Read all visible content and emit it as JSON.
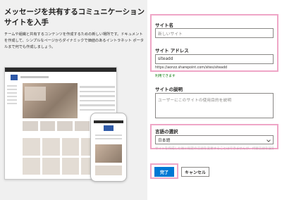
{
  "left": {
    "heading": "メッセージを共有するコミュニケーション サイトを入手",
    "description": "チームや組織と共有するコンテンツを作成するための新しい場所です。ドキュメントを作成して、シンプルなページからダイナミックで価値のあるイントラネット ポータルまで何でも作成しましょう。"
  },
  "form": {
    "site_name_label": "サイト名",
    "site_name_value": "新しいサイト",
    "site_address_label": "サイト アドレス",
    "site_address_value": "siteadd",
    "site_url": "https://aonzz.sharepoint.com/sites/siteadd",
    "availability": "利用できます",
    "description_label": "サイトの説明",
    "description_placeholder": "ユーザーにこのサイトの使用目的を説明",
    "language_label": "言語の選択",
    "language_value": "日本語",
    "language_note": "サイトを作成した後に既定の言語を変更することはできませんが、代替言語を設定することはできます",
    "finish_button": "完了",
    "cancel_button": "キャンセル"
  },
  "colors": {
    "highlight": "#efa6c7",
    "primary": "#0078d4",
    "available": "#107c10"
  }
}
